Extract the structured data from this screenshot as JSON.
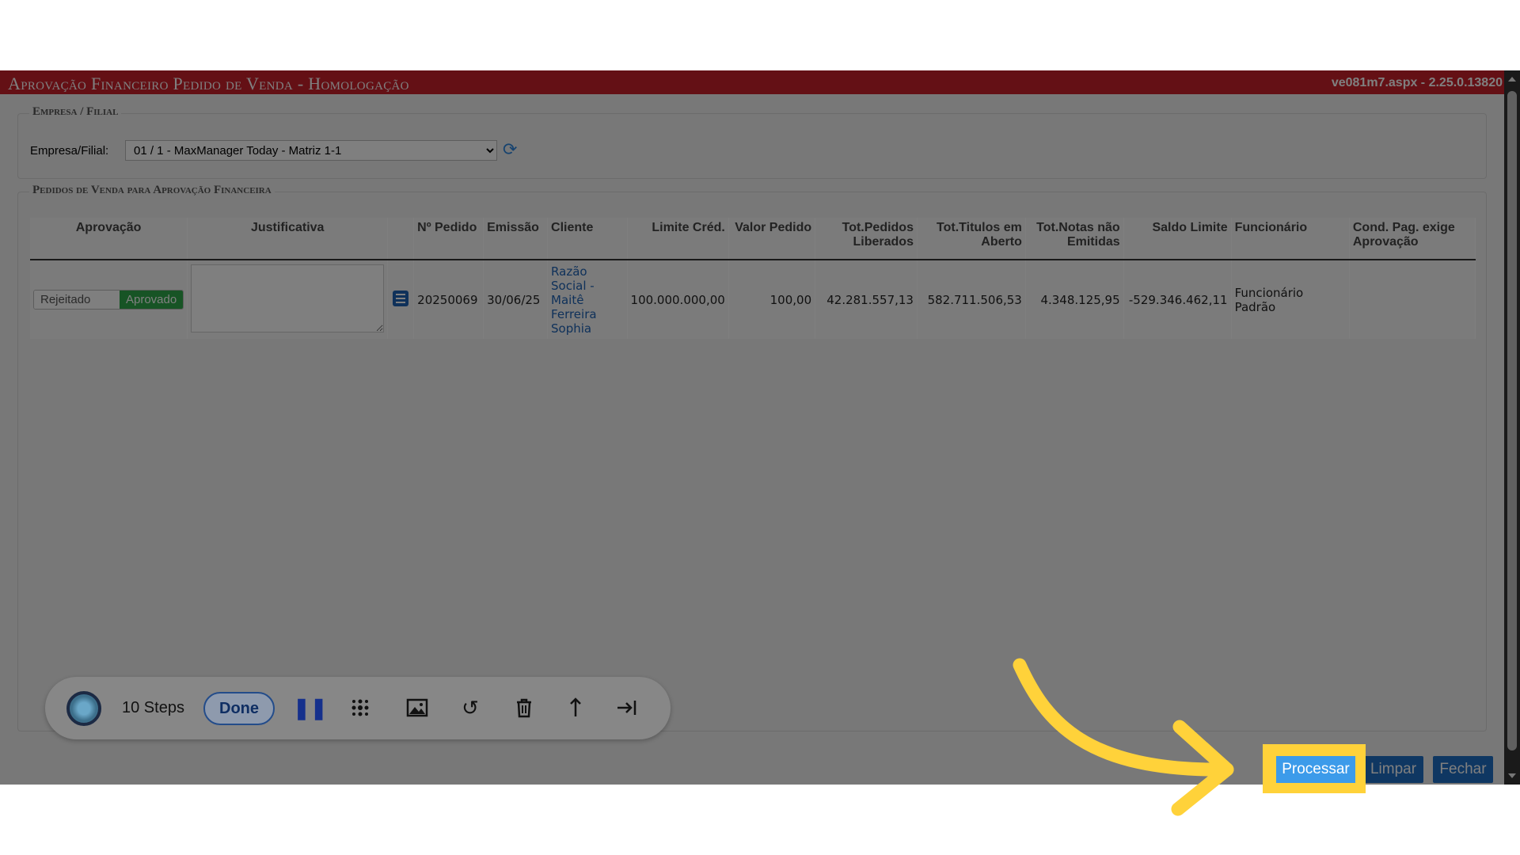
{
  "window": {
    "title": "Aprovação Financeiro Pedido de Venda  - Homologação",
    "version": "ve081m7.aspx - 2.25.0.13820"
  },
  "empresa_section": {
    "legend": "Empresa / Filial",
    "field_label": "Empresa/Filial:",
    "selected": "01 / 1 - MaxManager Today - Matriz 1-1"
  },
  "pedidos_section": {
    "legend": "Pedidos de Venda para Aprovação Financeira",
    "columns": [
      "Aprovação",
      "Justificativa",
      "",
      "Nº Pedido",
      "Emissão",
      "Cliente",
      "Limite Créd.",
      "Valor Pedido",
      "Tot.Pedidos Liberados",
      "Tot.Titulos em Aberto",
      "Tot.Notas não Emitidas",
      "Saldo Limite",
      "Funcionário",
      "Cond. Pag. exige Aprovação"
    ],
    "rows": [
      {
        "toggle_off": "Rejeitado",
        "toggle_on": "Aprovado",
        "justificativa": "",
        "pedido": "20250069",
        "emissao": "30/06/25",
        "cliente": "Razão Social - Maitê Ferreira Sophia",
        "limite": "100.000.000,00",
        "valor": "100,00",
        "tot_liberados": "42.281.557,13",
        "tot_titulos": "582.711.506,53",
        "tot_notas": "4.348.125,95",
        "saldo": "-529.346.462,11",
        "funcionario": "Funcionário Padrão",
        "cond_pag": ""
      }
    ]
  },
  "footer": {
    "processar": "Processar",
    "limpar": "Limpar",
    "fechar": "Fechar"
  },
  "recorder_toolbar": {
    "steps": "10 Steps",
    "done": "Done",
    "icons": [
      "pause-icon",
      "blur-icon",
      "image-icon",
      "undo-icon",
      "trash-icon",
      "arrow-up-icon",
      "skip-to-end-icon"
    ]
  },
  "colors": {
    "titlebar": "#c8202b",
    "approved": "#2ea84a",
    "primary_button": "#3c9bea",
    "highlight": "#ffd23a",
    "link": "#1f63b5"
  }
}
